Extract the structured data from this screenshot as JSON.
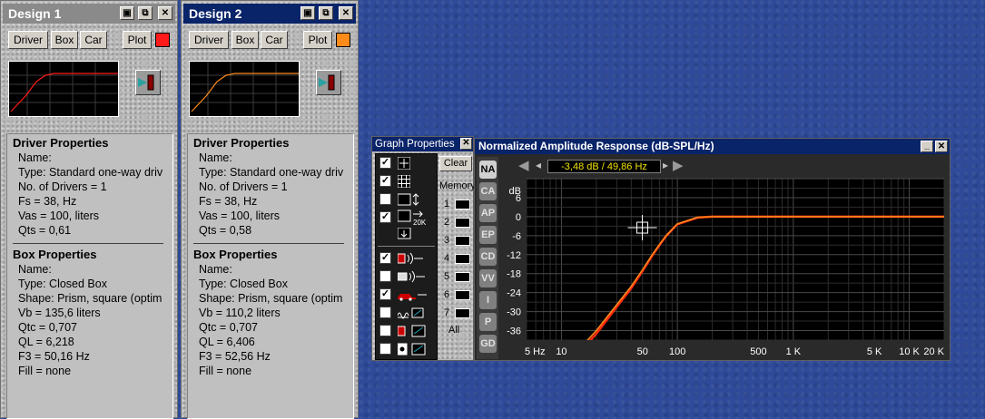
{
  "design1": {
    "title": "Design 1",
    "buttons": {
      "driver": "Driver",
      "box": "Box",
      "car": "Car",
      "plot": "Plot"
    },
    "plot_color": "#ff1a1a",
    "driver_props": {
      "heading": "Driver Properties",
      "name": "Name:",
      "type": "Type: Standard one-way driv",
      "drivers": "No. of Drivers = 1",
      "fs": "Fs = 38, Hz",
      "vas": "Vas = 100, liters",
      "qts": "Qts = 0,61"
    },
    "box_props": {
      "heading": "Box Properties",
      "name": "Name:",
      "type": "Type: Closed Box",
      "shape": "Shape: Prism, square (optim",
      "vb": "Vb = 135,6 liters",
      "qtc": "Qtc = 0,707",
      "ql": "QL = 6,218",
      "f3": "F3 = 50,16 Hz",
      "fill": "Fill = none"
    }
  },
  "design2": {
    "title": "Design 2",
    "buttons": {
      "driver": "Driver",
      "box": "Box",
      "car": "Car",
      "plot": "Plot"
    },
    "plot_color": "#ff8c1a",
    "driver_props": {
      "heading": "Driver Properties",
      "name": "Name:",
      "type": "Type: Standard one-way driv",
      "drivers": "No. of Drivers = 1",
      "fs": "Fs = 38, Hz",
      "vas": "Vas = 100, liters",
      "qts": "Qts = 0,58"
    },
    "box_props": {
      "heading": "Box Properties",
      "name": "Name:",
      "type": "Type: Closed Box",
      "shape": "Shape: Prism, square (optim",
      "vb": "Vb = 110,2 liters",
      "qtc": "Qtc = 0,707",
      "ql": "QL = 6,406",
      "f3": "F3 = 52,56 Hz",
      "fill": "Fill = none"
    }
  },
  "graph_props": {
    "title": "Graph Properties",
    "clear": "Clear",
    "memory": "Memory",
    "slots": [
      "1",
      "2",
      "3",
      "4",
      "5",
      "6",
      "7"
    ],
    "all": "All",
    "options": [
      {
        "icon": "crosshair-icon",
        "checked": true
      },
      {
        "icon": "grid-icon",
        "checked": true
      },
      {
        "icon": "vertical-scale-icon",
        "checked": false
      },
      {
        "icon": "20k-range-icon",
        "checked": true,
        "label": "20K"
      },
      {
        "icon": "scale-down-icon",
        "checked": false
      },
      {
        "icon": "driver-sound-icon",
        "checked": true
      },
      {
        "icon": "box-sound-icon",
        "checked": false
      },
      {
        "icon": "car-sound-icon",
        "checked": true
      },
      {
        "icon": "port-icon",
        "checked": false
      },
      {
        "icon": "speaker-graph-icon",
        "checked": false
      },
      {
        "icon": "enclosure-graph-icon",
        "checked": false
      }
    ]
  },
  "graph": {
    "title": "Normalized Amplitude Response (dB-SPL/Hz)",
    "readout": "-3,48 dB / 49,86 Hz",
    "side_tabs": [
      "NA",
      "CA",
      "AP",
      "EP",
      "CD",
      "VV",
      "I",
      "P",
      "GD"
    ],
    "active_tab": "NA",
    "y_unit": "dB",
    "colors": {
      "curve1": "#ff2a10",
      "curve2": "#ff8c1a",
      "background": "#000000"
    }
  },
  "chart_data": {
    "type": "line",
    "title": "Normalized Amplitude Response (dB-SPL/Hz)",
    "xlabel": "",
    "ylabel": "dB",
    "xscale": "log",
    "xlim": [
      5,
      20000
    ],
    "ylim": [
      -39,
      12
    ],
    "yticks": [
      6,
      0,
      -6,
      -12,
      -18,
      -24,
      -30,
      -36
    ],
    "ytick_labels": [
      "6",
      "0",
      "-6",
      "-12",
      "-18",
      "-24",
      "-30",
      "-36"
    ],
    "xticks": [
      5,
      10,
      50,
      100,
      500,
      1000,
      5000,
      10000,
      20000
    ],
    "xtick_labels": [
      "5 Hz",
      "10",
      "50",
      "100",
      "500",
      "1 K",
      "5 K",
      "10 K",
      "20 K"
    ],
    "grid": true,
    "series": [
      {
        "x": [
          5,
          10,
          20,
          30,
          40,
          50,
          60,
          70,
          80,
          100,
          150,
          200,
          500,
          1000,
          20000
        ],
        "values": [
          -61,
          -49,
          -37,
          -28.5,
          -22.6,
          -17.2,
          -12.6,
          -9,
          -6.1,
          -2.4,
          -0.3,
          0,
          0,
          0,
          0
        ]
      },
      {
        "x": [
          5,
          10,
          20,
          30,
          40,
          50,
          60,
          70,
          80,
          100,
          150,
          200,
          500,
          1000,
          20000
        ],
        "values": [
          -60,
          -48,
          -36,
          -27.8,
          -22,
          -16.8,
          -12.3,
          -8.8,
          -6,
          -2.3,
          -0.2,
          0,
          0,
          0,
          0
        ]
      }
    ],
    "cursor": {
      "x": 49.86,
      "y": -3.48
    }
  }
}
